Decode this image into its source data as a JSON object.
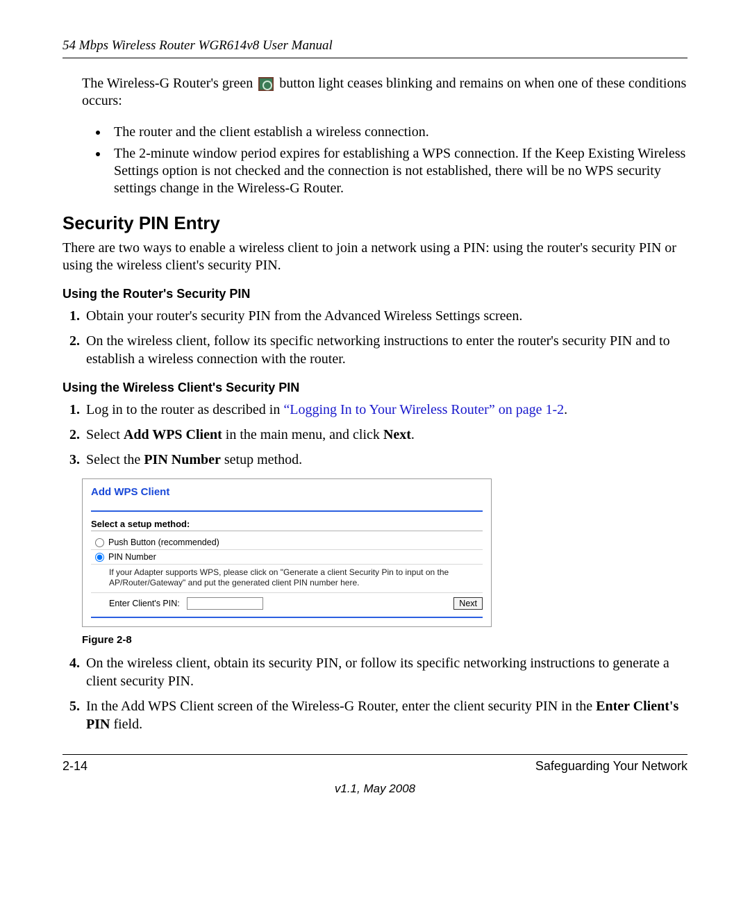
{
  "header": {
    "running": "54 Mbps Wireless Router WGR614v8 User Manual"
  },
  "intro": {
    "line1a": "The Wireless-G Router's green ",
    "line1b": " button light ceases blinking and remains on when one of these conditions occurs:",
    "bullet1": "The router and the client establish a wireless connection.",
    "bullet2": "The 2-minute window period expires for establishing a WPS connection. If the Keep Existing Wireless Settings option is not checked and the connection is not established, there will be no WPS security settings change in the Wireless-G Router."
  },
  "section": {
    "title": "Security PIN Entry",
    "para": "There are two ways to enable a wireless client to join a network using a PIN: using the router's security PIN or using the wireless client's security PIN."
  },
  "sub1": {
    "title": "Using the Router's Security PIN",
    "step1": "Obtain your router's security PIN from the Advanced Wireless Settings screen.",
    "step2": "On the wireless client, follow its specific networking instructions to enter the router's security PIN and to establish a wireless connection with the router."
  },
  "sub2": {
    "title": "Using the Wireless Client's Security PIN",
    "step1_a": "Log in to the router as described in ",
    "step1_link": "“Logging In to Your Wireless Router” on page 1-2",
    "step1_b": ".",
    "step2_a": "Select ",
    "step2_bold1": "Add WPS Client",
    "step2_b": " in the main menu, and click ",
    "step2_bold2": "Next",
    "step2_c": ".",
    "step3_a": "Select the ",
    "step3_bold": "PIN Number",
    "step3_b": " setup method.",
    "step4": "On the wireless client, obtain its security PIN, or follow its specific networking instructions to generate a client security PIN.",
    "step5_a": "In the Add WPS Client screen of the Wireless-G Router, enter the client security PIN in the ",
    "step5_bold": "Enter Client's PIN",
    "step5_b": " field."
  },
  "shot": {
    "title": "Add WPS Client",
    "select_label": "Select a setup method:",
    "radio_push": "Push Button (recommended)",
    "radio_pin": "PIN Number",
    "hint": "If your Adapter supports WPS, please click on \"Generate a client Security Pin to input on the AP/Router/Gateway\" and put the generated client PIN number here.",
    "enter_label": "Enter Client's PIN:",
    "next": "Next"
  },
  "figure_caption": "Figure 2-8",
  "footer": {
    "page": "2-14",
    "chapter": "Safeguarding Your Network",
    "version": "v1.1, May 2008"
  }
}
